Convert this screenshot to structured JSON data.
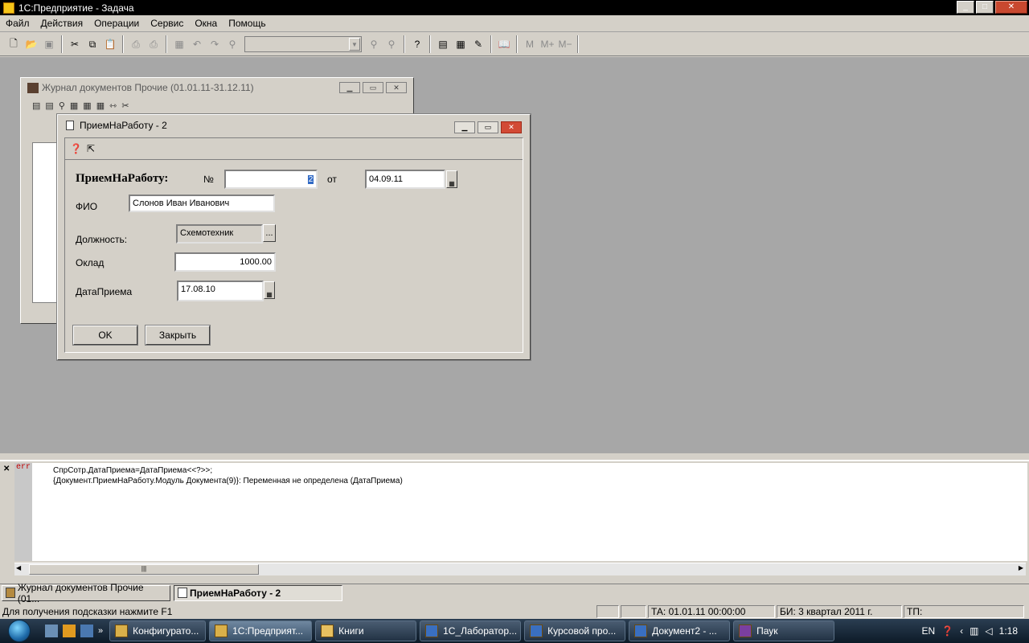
{
  "app": {
    "title": "1С:Предприятие - Задача"
  },
  "menu": [
    "Файл",
    "Действия",
    "Операции",
    "Сервис",
    "Окна",
    "Помощь"
  ],
  "toolbar": {
    "mem_buttons": [
      "M",
      "M+",
      "M−"
    ]
  },
  "journal_window": {
    "title": "Журнал документов Прочие (01.01.11-31.12.11)"
  },
  "dialog": {
    "title": "ПриемНаРаботу - 2",
    "header": "ПриемНаРаботу:",
    "number_label": "№",
    "number_value": "2",
    "from_label": "от",
    "date_value": "04.09.11",
    "fio_label": "ФИО",
    "fio_value": "Слонов Иван Иванович",
    "position_label": "Должность:",
    "position_value": "Схемотехник",
    "select_label": "...",
    "salary_label": "Оклад",
    "salary_value": "1000.00",
    "hire_date_label": "ДатаПриема",
    "hire_date_value": "17.08.10",
    "ok_label": "OK",
    "close_label": "Закрыть"
  },
  "errors": {
    "tag": "err",
    "line1": "СпрСотр.ДатаПриема=ДатаПриема<<?>>;",
    "line2": "{Документ.ПриемНаРаботу.Модуль Документа(9)}: Переменная не определена (ДатаПриема)"
  },
  "window_tabs": [
    "Журнал документов Прочие (01...",
    "ПриемНаРаботу - 2"
  ],
  "status": {
    "hint": "Для получения подсказки нажмите F1",
    "ta": "ТА: 01.01.11  00:00:00",
    "bi": "БИ: 3 квартал 2011 г.",
    "tp": "ТП:"
  },
  "taskbar": {
    "tasks": [
      "Конфигурато...",
      "1С:Предприят...",
      "Книги",
      "1С_Лаборатор...",
      "Курсовой про...",
      "Документ2 - ...",
      "Паук"
    ],
    "lang": "EN",
    "clock": "1:18"
  }
}
